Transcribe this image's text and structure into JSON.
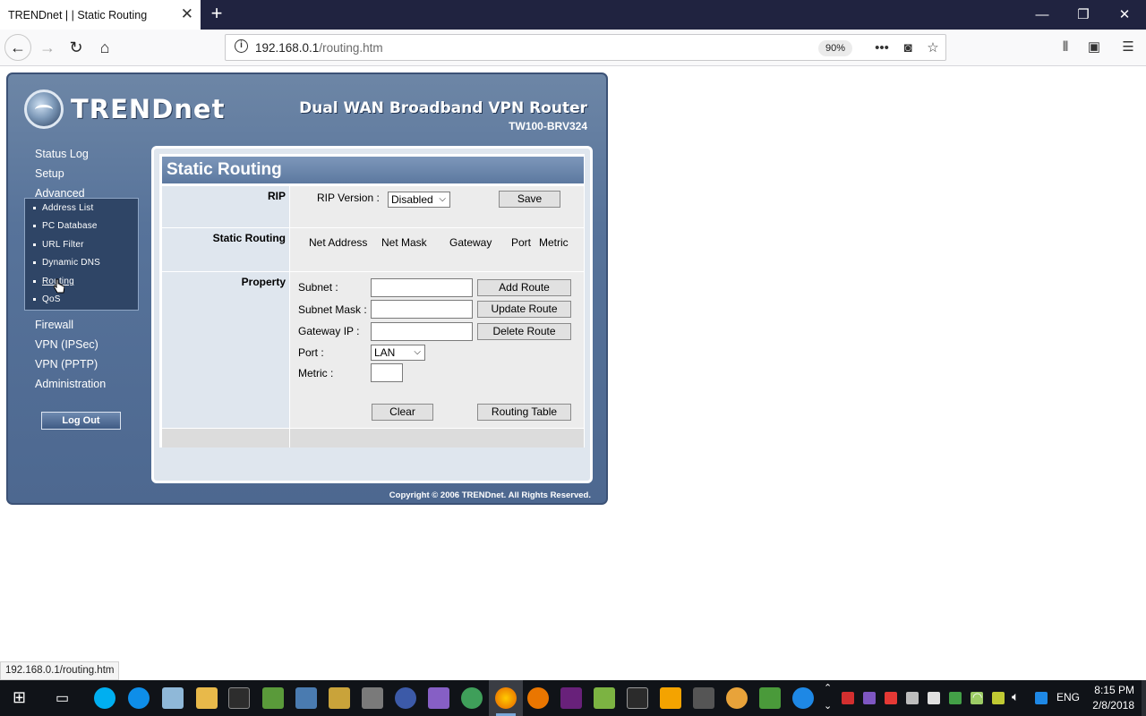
{
  "browser": {
    "tab_title": "TRENDnet | | Static Routing",
    "url_host": "192.168.0.1",
    "url_path": "/routing.htm",
    "zoom": "90%",
    "status_url": "192.168.0.1/routing.htm"
  },
  "brand": {
    "logo": "TRENDnet",
    "product_title": "Dual WAN Broadband VPN Router",
    "model": "TW100-BRV324",
    "copyright": "Copyright © 2006 TRENDnet. All Rights Reserved."
  },
  "sidebar": {
    "top_items": [
      {
        "label": "Status Log"
      },
      {
        "label": "Setup"
      },
      {
        "label": "Advanced"
      }
    ],
    "sub_items": [
      {
        "label": "Address List"
      },
      {
        "label": "PC Database"
      },
      {
        "label": "URL Filter"
      },
      {
        "label": "Dynamic DNS"
      },
      {
        "label": "Routing"
      },
      {
        "label": "QoS"
      }
    ],
    "bottom_items": [
      {
        "label": "Firewall"
      },
      {
        "label": "VPN (IPSec)"
      },
      {
        "label": "VPN (PPTP)"
      },
      {
        "label": "Administration"
      }
    ],
    "logout": "Log Out"
  },
  "main": {
    "title": "Static Routing",
    "rip": {
      "section": "RIP",
      "version_label": "RIP Version :",
      "version_value": "Disabled",
      "save": "Save"
    },
    "static_routing": {
      "section": "Static Routing",
      "columns": [
        "Net Address",
        "Net Mask",
        "Gateway",
        "Port",
        "Metric"
      ]
    },
    "property": {
      "section": "Property",
      "subnet_label": "Subnet :",
      "mask_label": "Subnet Mask :",
      "gateway_label": "Gateway IP :",
      "port_label": "Port :",
      "port_value": "LAN",
      "metric_label": "Metric :",
      "add_route": "Add Route",
      "update_route": "Update Route",
      "delete_route": "Delete Route",
      "clear": "Clear",
      "routing_table": "Routing Table"
    }
  },
  "taskbar": {
    "language": "ENG",
    "time": "8:15 PM",
    "date": "2/8/2018"
  }
}
